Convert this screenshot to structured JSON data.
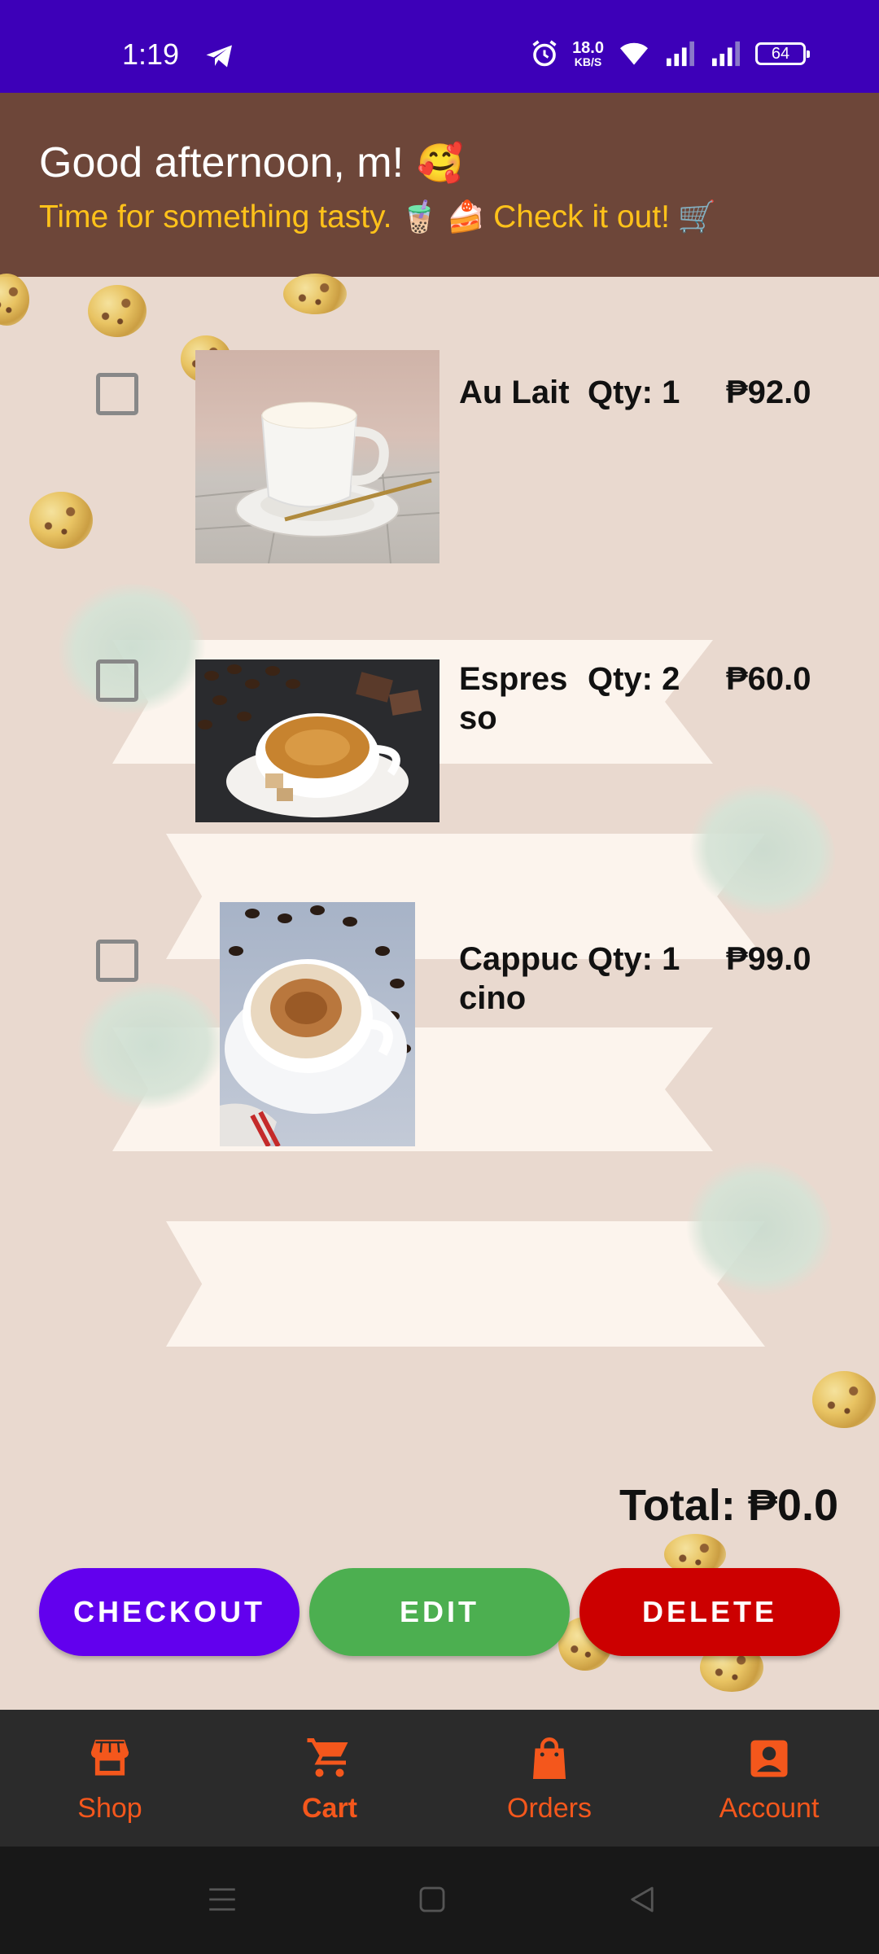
{
  "status_bar": {
    "time": "1:19",
    "net_speed": "18.0",
    "net_unit": "KB/S",
    "battery": "64"
  },
  "header": {
    "greeting": "Good afternoon, m!",
    "greeting_emoji": "🥰",
    "subtitle_part1": "Time for something tasty.",
    "subtitle_emoji1": "🧋",
    "subtitle_emoji2": "🍰",
    "subtitle_part2": "Check it out!",
    "subtitle_emoji3": "🛒"
  },
  "cart": {
    "items": [
      {
        "name": "Au Lait",
        "qty": "Qty: 1",
        "price": "₱92.0",
        "checked": false
      },
      {
        "name": "Espresso",
        "qty": "Qty: 2",
        "price": "₱60.0",
        "checked": false
      },
      {
        "name": "Cappuccino",
        "qty": "Qty: 1",
        "price": "₱99.0",
        "checked": false
      }
    ],
    "total": "Total: ₱0.0"
  },
  "actions": {
    "checkout": "CHECKOUT",
    "edit": "EDIT",
    "delete": "DELETE"
  },
  "nav": {
    "items": [
      {
        "label": "Shop",
        "icon": "store-icon"
      },
      {
        "label": "Cart",
        "icon": "cart-icon",
        "active": true
      },
      {
        "label": "Orders",
        "icon": "shopping-bag-icon"
      },
      {
        "label": "Account",
        "icon": "account-box-icon"
      }
    ]
  },
  "colors": {
    "status_bar": "#3d00b8",
    "header": "#6d4639",
    "accent_yellow": "#ffc21a",
    "checkout": "#6200ee",
    "edit": "#4caf50",
    "delete": "#cc0000",
    "nav_accent": "#f4571c"
  }
}
